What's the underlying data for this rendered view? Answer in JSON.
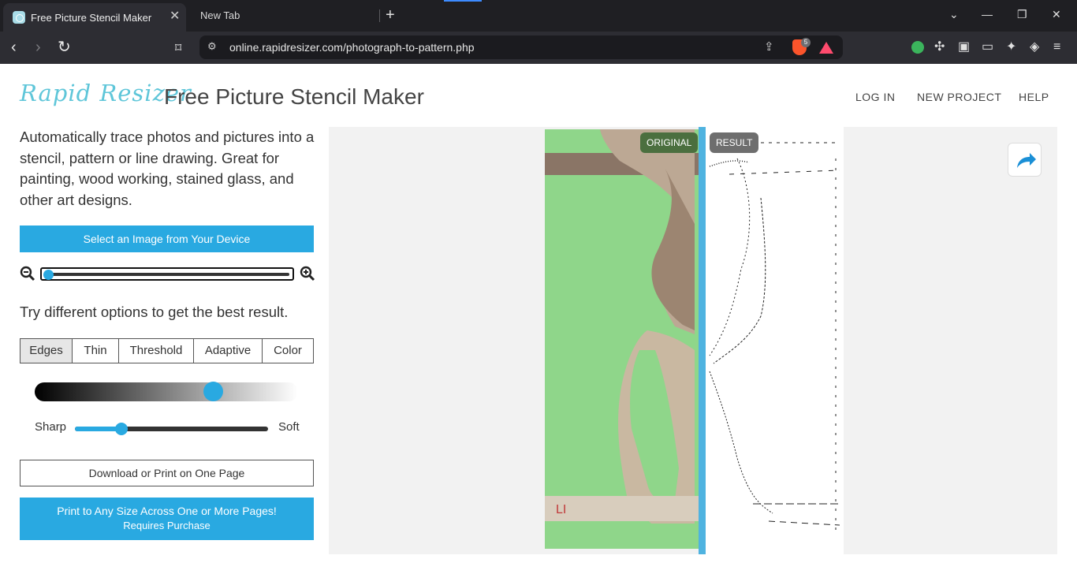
{
  "browser": {
    "active_tab_title": "Free Picture Stencil Maker",
    "inactive_tab_title": "New Tab",
    "close_glyph": "✕",
    "new_tab_glyph": "+",
    "url": "online.rapidresizer.com/photograph-to-pattern.php",
    "shield_count": "5"
  },
  "site": {
    "logo_text": "Rapid Resizer",
    "title": "Free Picture Stencil Maker",
    "nav": [
      "LOG IN",
      "NEW PROJECT",
      "HELP"
    ],
    "accent_color": "#29a9e1"
  },
  "sidebar": {
    "intro": "Automatically trace photos and pictures into a stencil, pattern or line drawing. Great for painting, wood working, stained glass, and other art designs.",
    "select_button": "Select an Image from Your Device",
    "zoom_level": 0,
    "options_heading": "Try different options to get the best result.",
    "modes": [
      "Edges",
      "Thin",
      "Threshold",
      "Adaptive",
      "Color"
    ],
    "active_mode": "Edges",
    "threshold_level": 0.7,
    "sharp_label": "Sharp",
    "soft_label": "Soft",
    "sharpness_level": 0.24,
    "download_button": "Download or Print on One Page",
    "print_button_main": "Print to Any Size Across One or More Pages!",
    "print_button_sub": "Requires Purchase"
  },
  "preview": {
    "original_label": "ORIGINAL",
    "result_label": "RESULT",
    "photo_annotation": "LI"
  }
}
